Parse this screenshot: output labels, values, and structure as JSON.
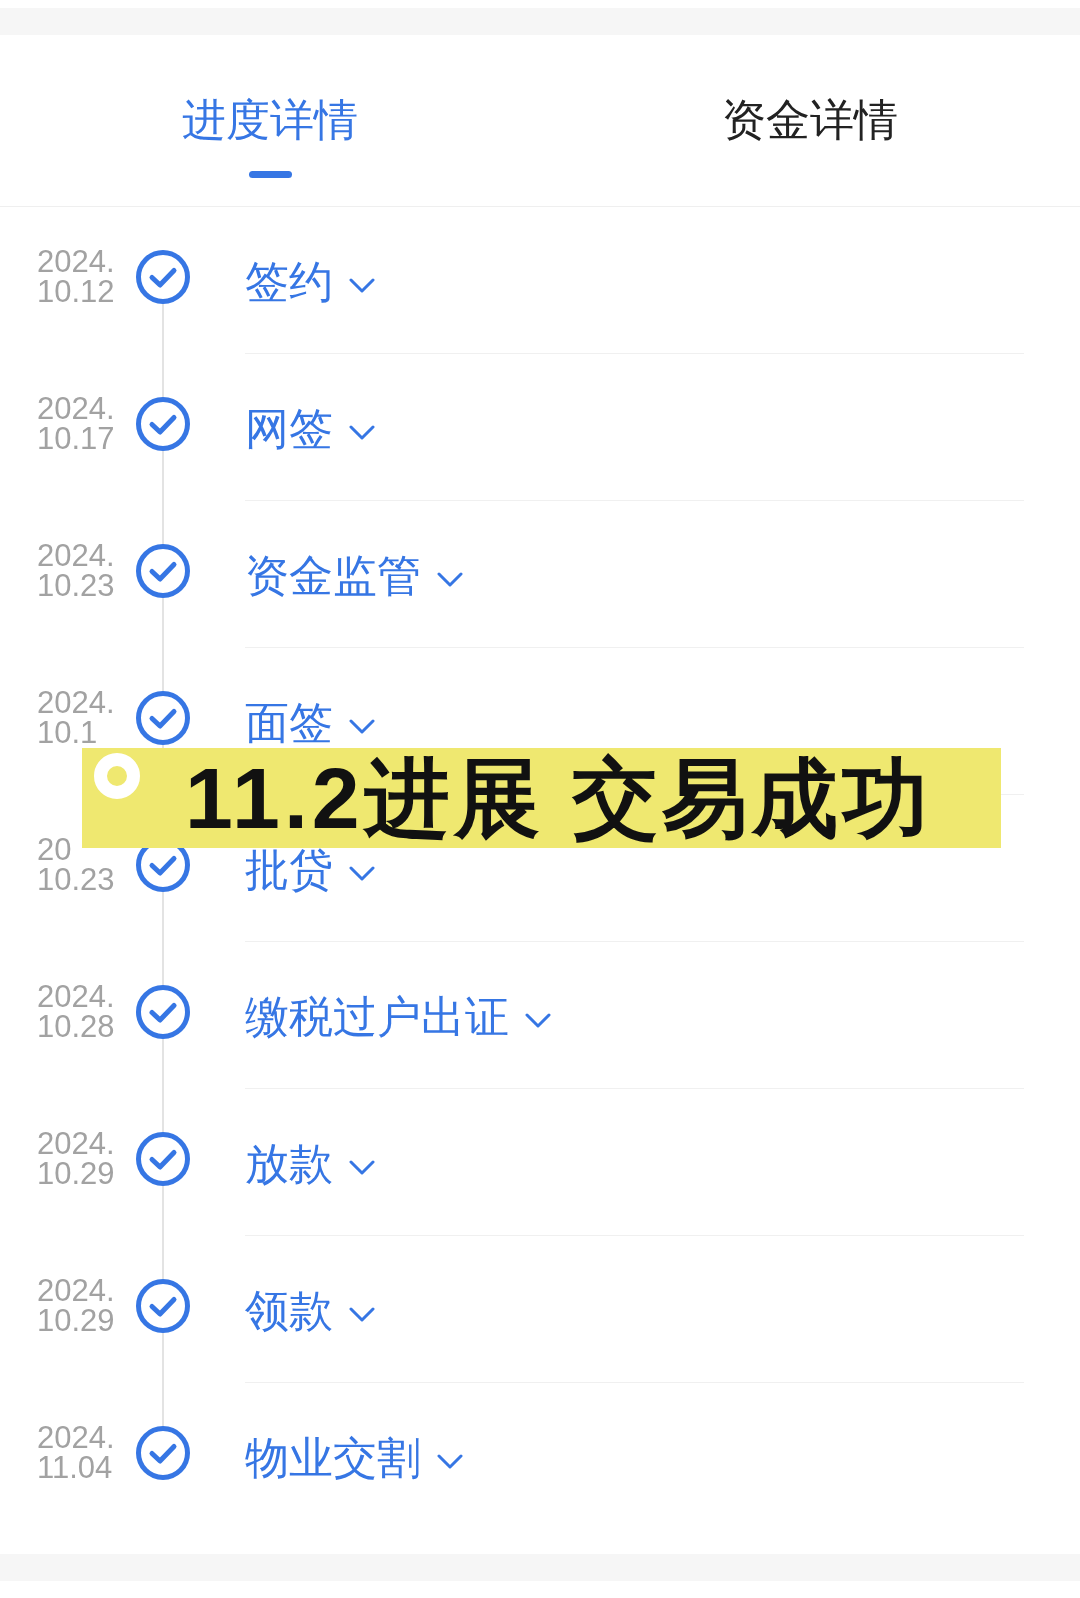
{
  "tabs": [
    {
      "label": "进度详情",
      "selected": true
    },
    {
      "label": "资金详情",
      "selected": false
    }
  ],
  "steps": [
    {
      "year": "2024.",
      "day": "10.12",
      "label": "签约",
      "done": true
    },
    {
      "year": "2024.",
      "day": "10.17",
      "label": "网签",
      "done": true
    },
    {
      "year": "2024.",
      "day": "10.23",
      "label": "资金监管",
      "done": true
    },
    {
      "year": "2024.",
      "day": "10.1",
      "label": "面签",
      "done": true
    },
    {
      "year": "20",
      "day": "10.23",
      "label": "批贷",
      "done": true
    },
    {
      "year": "2024.",
      "day": "10.28",
      "label": "缴税过户出证",
      "done": true
    },
    {
      "year": "2024.",
      "day": "10.29",
      "label": "放款",
      "done": true
    },
    {
      "year": "2024.",
      "day": "10.29",
      "label": "领款",
      "done": true
    },
    {
      "year": "2024.",
      "day": "11.04",
      "label": "物业交割",
      "done": true
    }
  ],
  "banner": {
    "text": "11.2进展 交易成功"
  }
}
